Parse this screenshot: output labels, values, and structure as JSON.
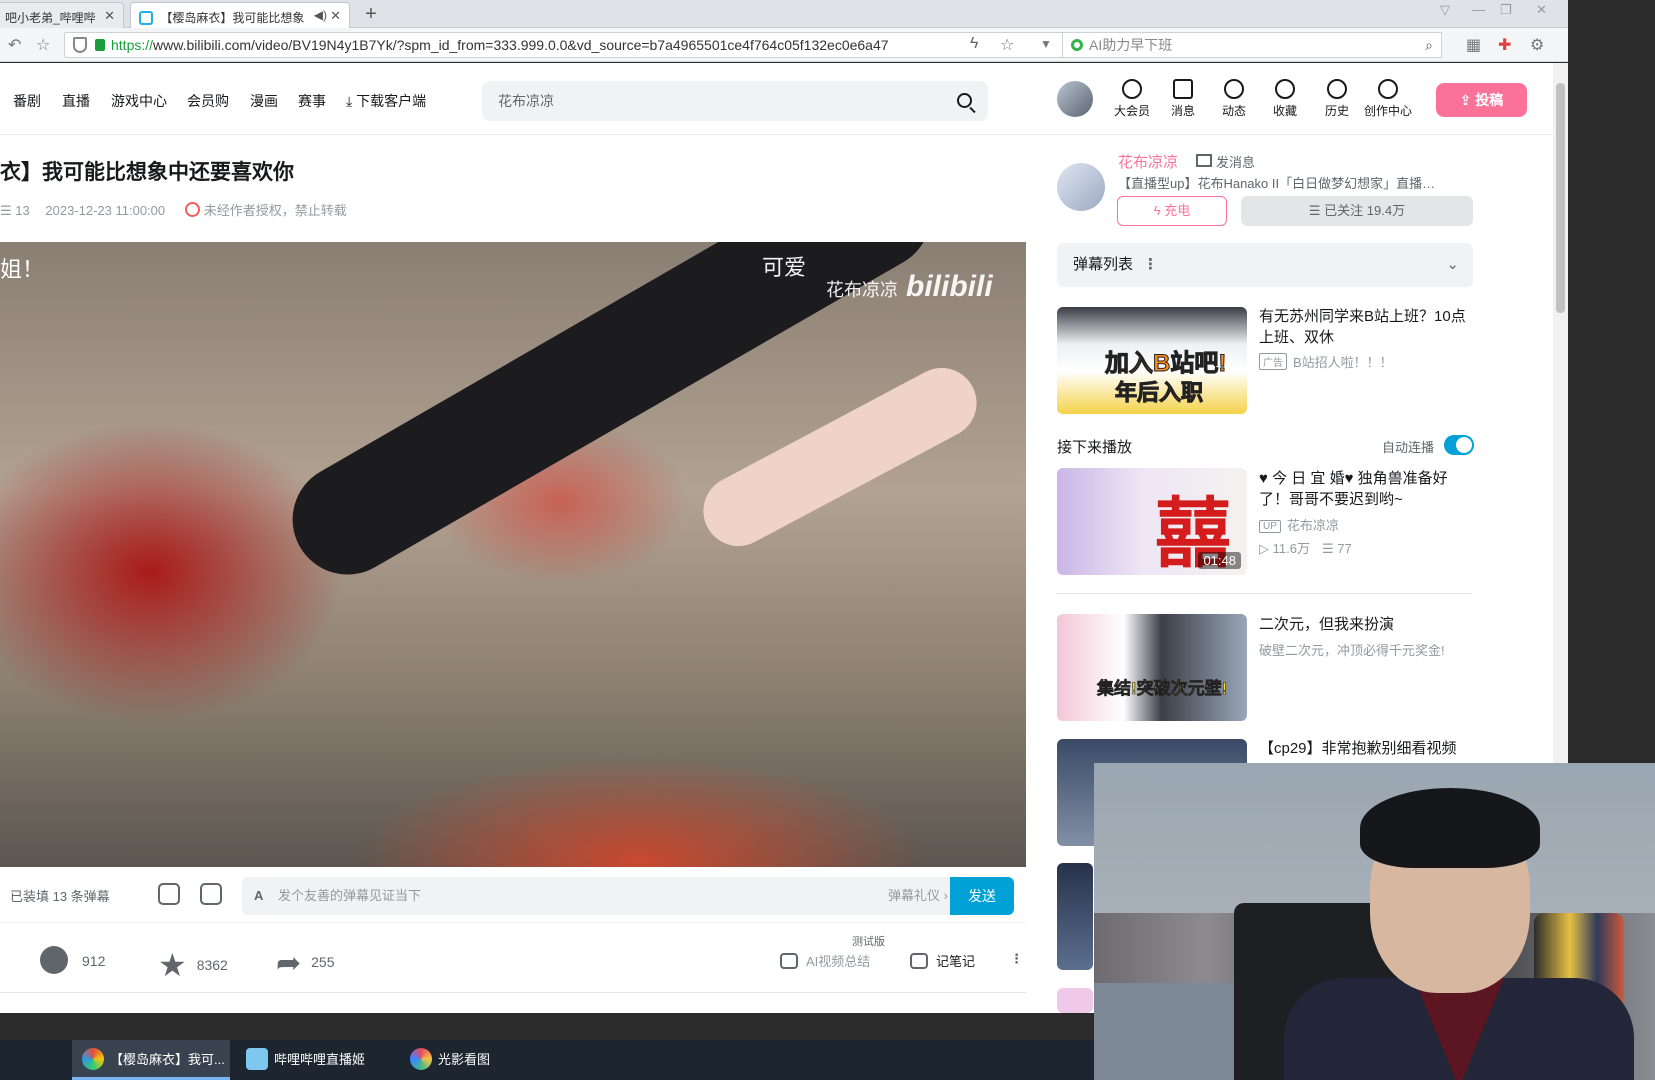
{
  "browser": {
    "tabs": [
      {
        "label": "吧小老弟_哔哩哔",
        "active": false
      },
      {
        "label": "【樱岛麻衣】我可能比想象",
        "active": true
      }
    ],
    "url_proto": "https://",
    "url_rest": "www.bilibili.com/video/BV19N4y1B7Yk/?spm_id_from=333.999.0.0&vd_source=b7a4965501ce4f764c05f132ec0e6a47",
    "search_placeholder": "AI助力早下班"
  },
  "header": {
    "nav": [
      "番剧",
      "直播",
      "游戏中心",
      "会员购",
      "漫画",
      "赛事",
      "下载客户端"
    ],
    "search_value": "花布凉凉",
    "icons": [
      {
        "label": "大会员",
        "icon": "vip-icon"
      },
      {
        "label": "消息",
        "icon": "message-icon"
      },
      {
        "label": "动态",
        "icon": "dynamic-icon"
      },
      {
        "label": "收藏",
        "icon": "favorite-icon"
      },
      {
        "label": "历史",
        "icon": "history-icon"
      },
      {
        "label": "创作中心",
        "icon": "creator-icon"
      }
    ],
    "upload_label": "投稿"
  },
  "video": {
    "title": "衣】我可能比想象中还要喜欢你",
    "danmaku_count": "13",
    "date": "2023-12-23 11:00:00",
    "copyright": "未经作者授权，禁止转载",
    "overlay_left": "姐！",
    "overlay_cute": "可爱",
    "watermark": "花布凉凉",
    "watermark_logo": "bilibili"
  },
  "danmaku_bar": {
    "loaded": "已装填 13 条弹幕",
    "placeholder": "发个友善的弹幕见证当下",
    "etiquette": "弹幕礼仪 ›",
    "send": "发送"
  },
  "actions": {
    "coin": "912",
    "favorite": "8362",
    "share": "255",
    "beta_tag": "测试版",
    "ai_summary": "AI视频总结",
    "notes": "记笔记"
  },
  "uploader": {
    "name": "花布凉凉",
    "message": "发消息",
    "desc": "【直播型up】花布Hanako II「白日做梦幻想家」直播…",
    "charge": "充电",
    "followed": "已关注 19.4万"
  },
  "sidebar": {
    "danmaku_list": "弹幕列表",
    "ad": {
      "title": "有无苏州同学来B站上班？10点上班、双休",
      "tag": "广告",
      "sub": "B站招人啦！！！",
      "thumb_text_1": "加入B站吧!",
      "thumb_text_2": "年后入职"
    },
    "next_label": "接下来播放",
    "autoplay": "自动连播",
    "cards": [
      {
        "title": "♥ 今 日 宜 婚♥ 独角兽准备好了！哥哥不要迟到哟~",
        "up": "花布凉凉",
        "views": "11.6万",
        "danmaku": "77",
        "duration": "01:48",
        "thumb_text": "囍"
      },
      {
        "title": "二次元，但我来扮演",
        "sub": "破壁二次元，冲顶必得千元奖金!",
        "thumb_text": "集结!突破次元壁!"
      },
      {
        "title": "【cp29】非常抱歉别细看视频"
      }
    ]
  },
  "taskbar": [
    {
      "label": "【樱岛麻衣】我可...",
      "active": true
    },
    {
      "label": "哔哩哔哩直播姬",
      "active": false
    },
    {
      "label": "光影看图",
      "active": false
    }
  ]
}
